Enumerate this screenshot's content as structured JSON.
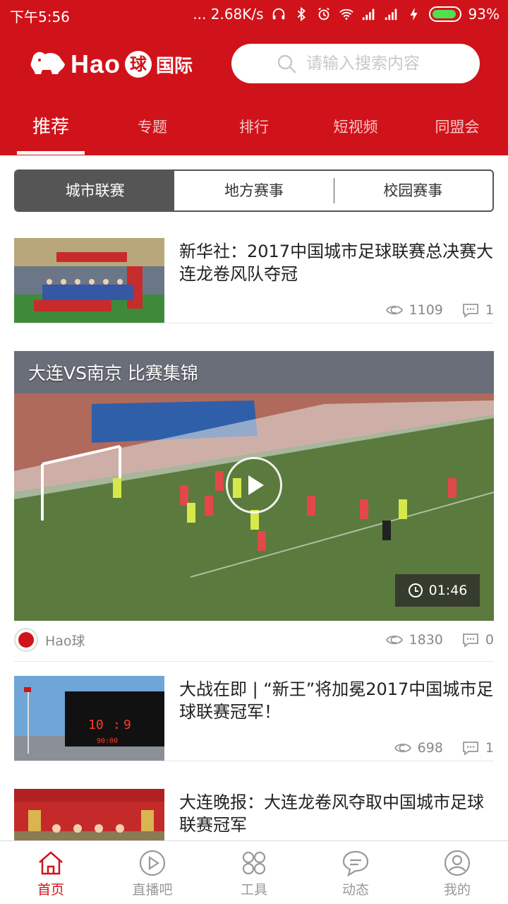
{
  "status_bar": {
    "time": "下午5:56",
    "network_speed": "... 2.68K/s",
    "battery_percent": "93%",
    "battery_level": 0.93
  },
  "header": {
    "logo_text": "Hao",
    "logo_ball": "球",
    "logo_sub": "国际",
    "brand_color": "#d0131a"
  },
  "search": {
    "placeholder": "请输入搜索内容"
  },
  "tabs": [
    {
      "label": "推荐",
      "active": true
    },
    {
      "label": "专题",
      "active": false
    },
    {
      "label": "排行",
      "active": false
    },
    {
      "label": "短视频",
      "active": false
    },
    {
      "label": "同盟会",
      "active": false
    }
  ],
  "segments": [
    {
      "label": "城市联赛",
      "active": true
    },
    {
      "label": "地方赛事",
      "active": false
    },
    {
      "label": "校园赛事",
      "active": false
    }
  ],
  "feed": {
    "items": [
      {
        "title": "新华社：2017中国城市足球联赛总决赛大连龙卷风队夺冠",
        "views": "1109",
        "comments": "1"
      },
      {
        "title": "大战在即 | “新王”将加冕2017中国城市足球联赛冠军！",
        "views": "698",
        "comments": "1"
      },
      {
        "title": "大连晚报：大连龙卷风夺取中国城市足球联赛冠军",
        "views": "",
        "comments": ""
      }
    ],
    "video": {
      "title": "大连VS南京 比赛集锦",
      "duration": "01:46",
      "source": "Hao球",
      "views": "1830",
      "comments": "0"
    },
    "scoreboard": {
      "home": "10",
      "away": "9",
      "time": "90:00"
    }
  },
  "bottom_nav": [
    {
      "label": "首页",
      "icon": "home-icon",
      "active": true
    },
    {
      "label": "直播吧",
      "icon": "play-circle-icon",
      "active": false
    },
    {
      "label": "工具",
      "icon": "tools-grid-icon",
      "active": false
    },
    {
      "label": "动态",
      "icon": "chat-bubble-icon",
      "active": false
    },
    {
      "label": "我的",
      "icon": "user-icon",
      "active": false
    }
  ]
}
